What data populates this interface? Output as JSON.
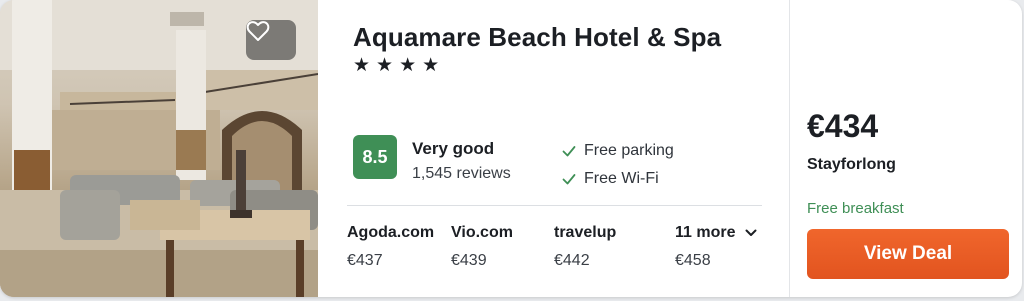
{
  "hotel": {
    "name": "Aquamare Beach Hotel & Spa",
    "stars": [
      "★",
      "★",
      "★",
      "★"
    ],
    "star_count": 4
  },
  "rating": {
    "score": "8.5",
    "label": "Very good",
    "reviews": "1,545 reviews"
  },
  "amenities": [
    {
      "label": "Free parking",
      "icon": "check-icon"
    },
    {
      "label": "Free Wi-Fi",
      "icon": "check-icon"
    }
  ],
  "offers": [
    {
      "site": "Agoda.com",
      "price": "€437"
    },
    {
      "site": "Vio.com",
      "price": "€439"
    },
    {
      "site": "travelup",
      "price": "€442"
    },
    {
      "site": "11 more",
      "price": "€458",
      "icon": "chevron-down-icon"
    }
  ],
  "deal": {
    "price": "€434",
    "provider": "Stayforlong",
    "perk": "Free breakfast",
    "button_label": "View Deal"
  },
  "colors": {
    "score_badge": "#3f8f56",
    "perk_text": "#3f8f56",
    "deal_button": "#e95a23",
    "favorite_overlay": "#3c3c3c"
  },
  "icons": {
    "favorite": "heart-icon",
    "amenity": "check-icon",
    "more": "chevron-down-icon"
  }
}
